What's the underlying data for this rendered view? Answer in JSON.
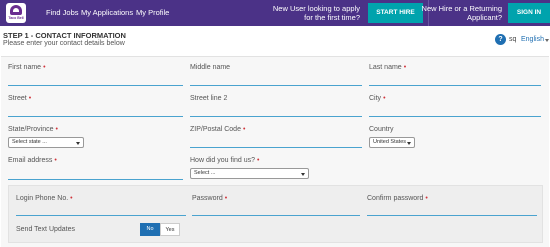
{
  "nav": {
    "logo_text": "Taco Bell",
    "items": [
      "Find Jobs",
      "My Applications",
      "My Profile"
    ]
  },
  "promo": {
    "new_user": "New User looking to apply for the first time?",
    "start_hire": "START HIRE",
    "returning": "New Hire or a Returning Applicant?",
    "sign_in": "SIGN IN"
  },
  "step": {
    "title": "STEP 1 - CONTACT INFORMATION",
    "subtitle": "Please enter your contact details below"
  },
  "language": {
    "help": "?",
    "code": "sq",
    "selected": "English"
  },
  "fields": {
    "first_name": "First name",
    "middle_name": "Middle name",
    "last_name": "Last name",
    "street": "Street",
    "street2": "Street line 2",
    "city": "City",
    "state": "State/Province",
    "state_value": "Select state ...",
    "zip": "ZIP/Postal Code",
    "country": "Country",
    "country_value": "United States",
    "email": "Email address",
    "found_us": "How did you find us?",
    "found_us_value": "Select ..."
  },
  "login": {
    "phone": "Login Phone No.",
    "password": "Password",
    "confirm": "Confirm password",
    "sms": "Send Text Updates",
    "no": "No",
    "yes": "Yes"
  },
  "colors": {
    "nav_bg": "#4b3287",
    "cta": "#00a3ad",
    "field_line": "#4aa3cf",
    "required": "#d0343b",
    "toggle_active": "#1f6fb2"
  }
}
